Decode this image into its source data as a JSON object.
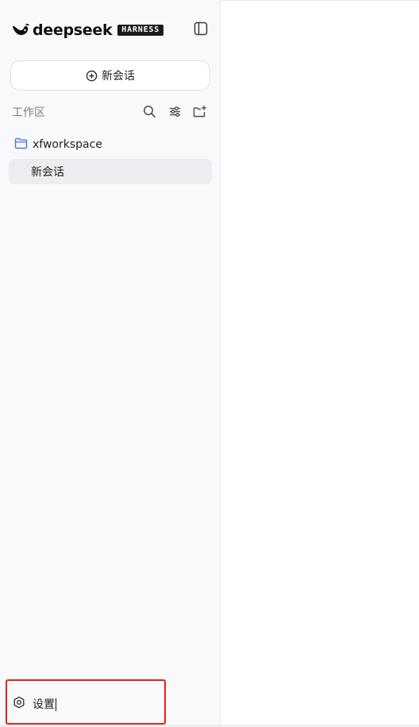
{
  "header": {
    "brand_name": "deepseek",
    "badge": "HARNESS",
    "logo_icon": "whale-logo-icon",
    "toggle_icon": "sidebar-toggle-icon"
  },
  "new_chat": {
    "label": "新会话",
    "icon": "plus-circle-icon"
  },
  "workspace": {
    "title": "工作区",
    "tools": [
      {
        "name": "search-icon"
      },
      {
        "name": "filter-sliders-icon"
      },
      {
        "name": "new-folder-icon"
      }
    ]
  },
  "tree": {
    "folder": {
      "label": "xfworkspace",
      "icon": "folder-icon"
    },
    "items": [
      {
        "label": "新会话",
        "selected": true
      }
    ]
  },
  "footer": {
    "settings_label": "设置",
    "settings_icon": "gear-icon"
  },
  "colors": {
    "sidebar_bg": "#f8f9fb",
    "selected_bg": "#ecedf0",
    "folder_accent": "#4a7bd8",
    "highlight": "#e2231a"
  }
}
